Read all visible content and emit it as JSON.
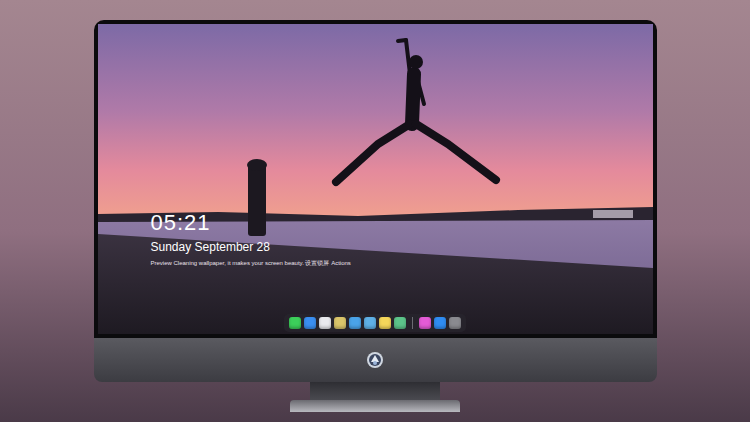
{
  "lock_screen": {
    "time": "05:21",
    "date": "Sunday September 28",
    "caption": "Preview Cleaning wallpaper, it makes your screen beauty. 设置锁屏  Actions"
  },
  "dock": {
    "items": [
      {
        "kind": "app",
        "color": "#3ccf5a"
      },
      {
        "kind": "app",
        "color": "#3a8ef0"
      },
      {
        "kind": "app",
        "color": "#e9e9ee"
      },
      {
        "kind": "app",
        "color": "#d9c46a"
      },
      {
        "kind": "app",
        "color": "#4aa3e8"
      },
      {
        "kind": "app",
        "color": "#5fb0e6"
      },
      {
        "kind": "app",
        "color": "#f4d65a"
      },
      {
        "kind": "app",
        "color": "#5cc48a"
      },
      {
        "kind": "separator",
        "color": "#6b6b72"
      },
      {
        "kind": "app",
        "color": "#e45bd6"
      },
      {
        "kind": "app",
        "color": "#2f8cf2"
      },
      {
        "kind": "app",
        "color": "#8a8a90"
      }
    ]
  }
}
